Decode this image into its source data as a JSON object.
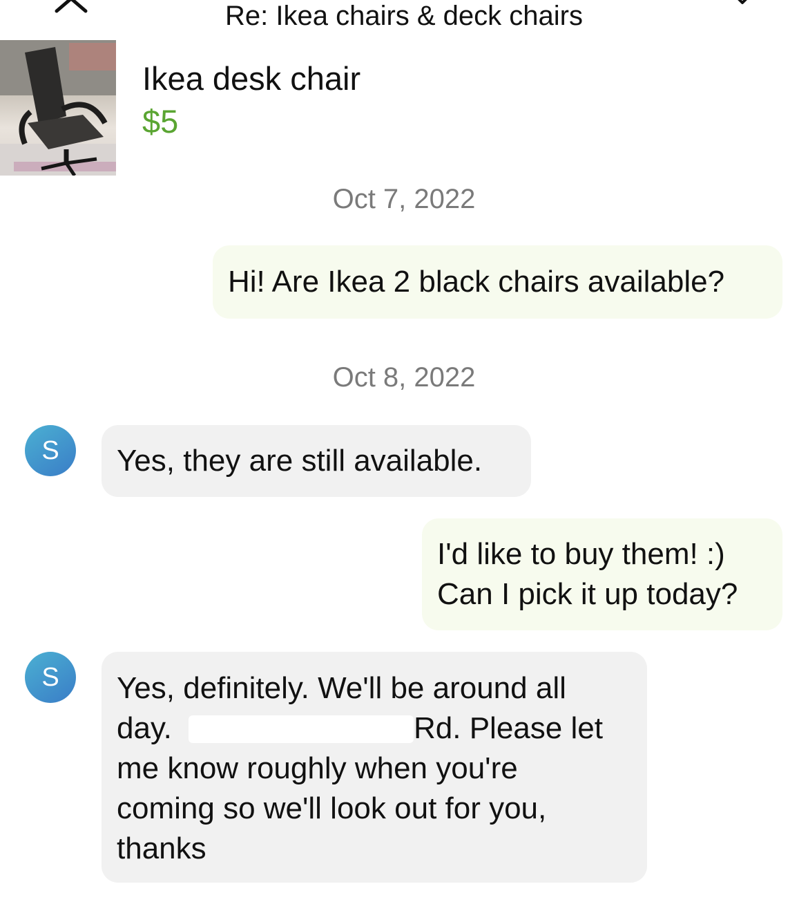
{
  "header": {
    "title": "Re: Ikea chairs & deck chairs",
    "close_icon": "close-icon",
    "more_icon": "chevron-down-icon"
  },
  "listing": {
    "title": "Ikea desk chair",
    "price": "$5",
    "price_color": "#5aa532"
  },
  "messages": [
    {
      "type": "date",
      "text": "Oct 7, 2022"
    },
    {
      "type": "outgoing",
      "text": "Hi! Are Ikea 2 black chairs available?"
    },
    {
      "type": "date",
      "text": "Oct 8, 2022"
    },
    {
      "type": "incoming",
      "avatar": "S",
      "text": "Yes, they are still available."
    },
    {
      "type": "outgoing",
      "lines": [
        "I'd like to buy them! :)",
        "Can I pick it up today?"
      ]
    },
    {
      "type": "incoming",
      "avatar": "S",
      "lines": [
        "Yes, definitely.  We'll be around all",
        "day.",
        "Rd. Please let",
        "me know roughly when you're",
        "coming so we'll look out for you,",
        "thanks"
      ]
    }
  ],
  "colors": {
    "outgoing_bubble": "#f7fbee",
    "incoming_bubble": "#f1f1f1",
    "avatar_gradient_start": "#4bb0d2",
    "avatar_gradient_end": "#3a7dc7",
    "date_text": "#7a7a7a"
  }
}
